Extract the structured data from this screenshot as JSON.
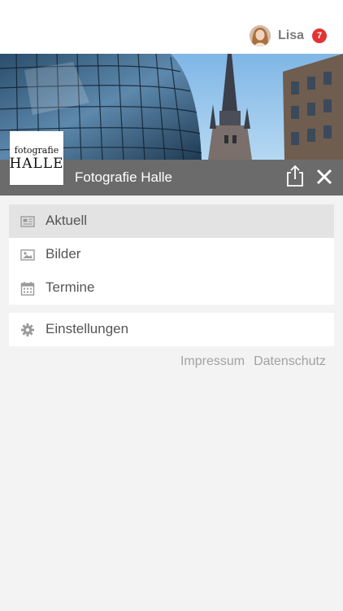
{
  "user": {
    "name": "Lisa",
    "notification_count": "7"
  },
  "logo": {
    "line1": "fotografie",
    "line2": "HALLE"
  },
  "header": {
    "title": "Fotografie Halle"
  },
  "menu": {
    "items": [
      {
        "label": "Aktuell",
        "icon": "newspaper-icon",
        "active": true
      },
      {
        "label": "Bilder",
        "icon": "image-icon",
        "active": false
      },
      {
        "label": "Termine",
        "icon": "calendar-icon",
        "active": false
      }
    ],
    "settings": {
      "label": "Einstellungen",
      "icon": "gear-icon"
    }
  },
  "footer_links": {
    "impressum": "Impressum",
    "datenschutz": "Datenschutz"
  },
  "colors": {
    "badge": "#e03434",
    "titlebar": "#6b6b6b",
    "active_item": "#e3e3e3",
    "background": "#f3f3f3"
  }
}
